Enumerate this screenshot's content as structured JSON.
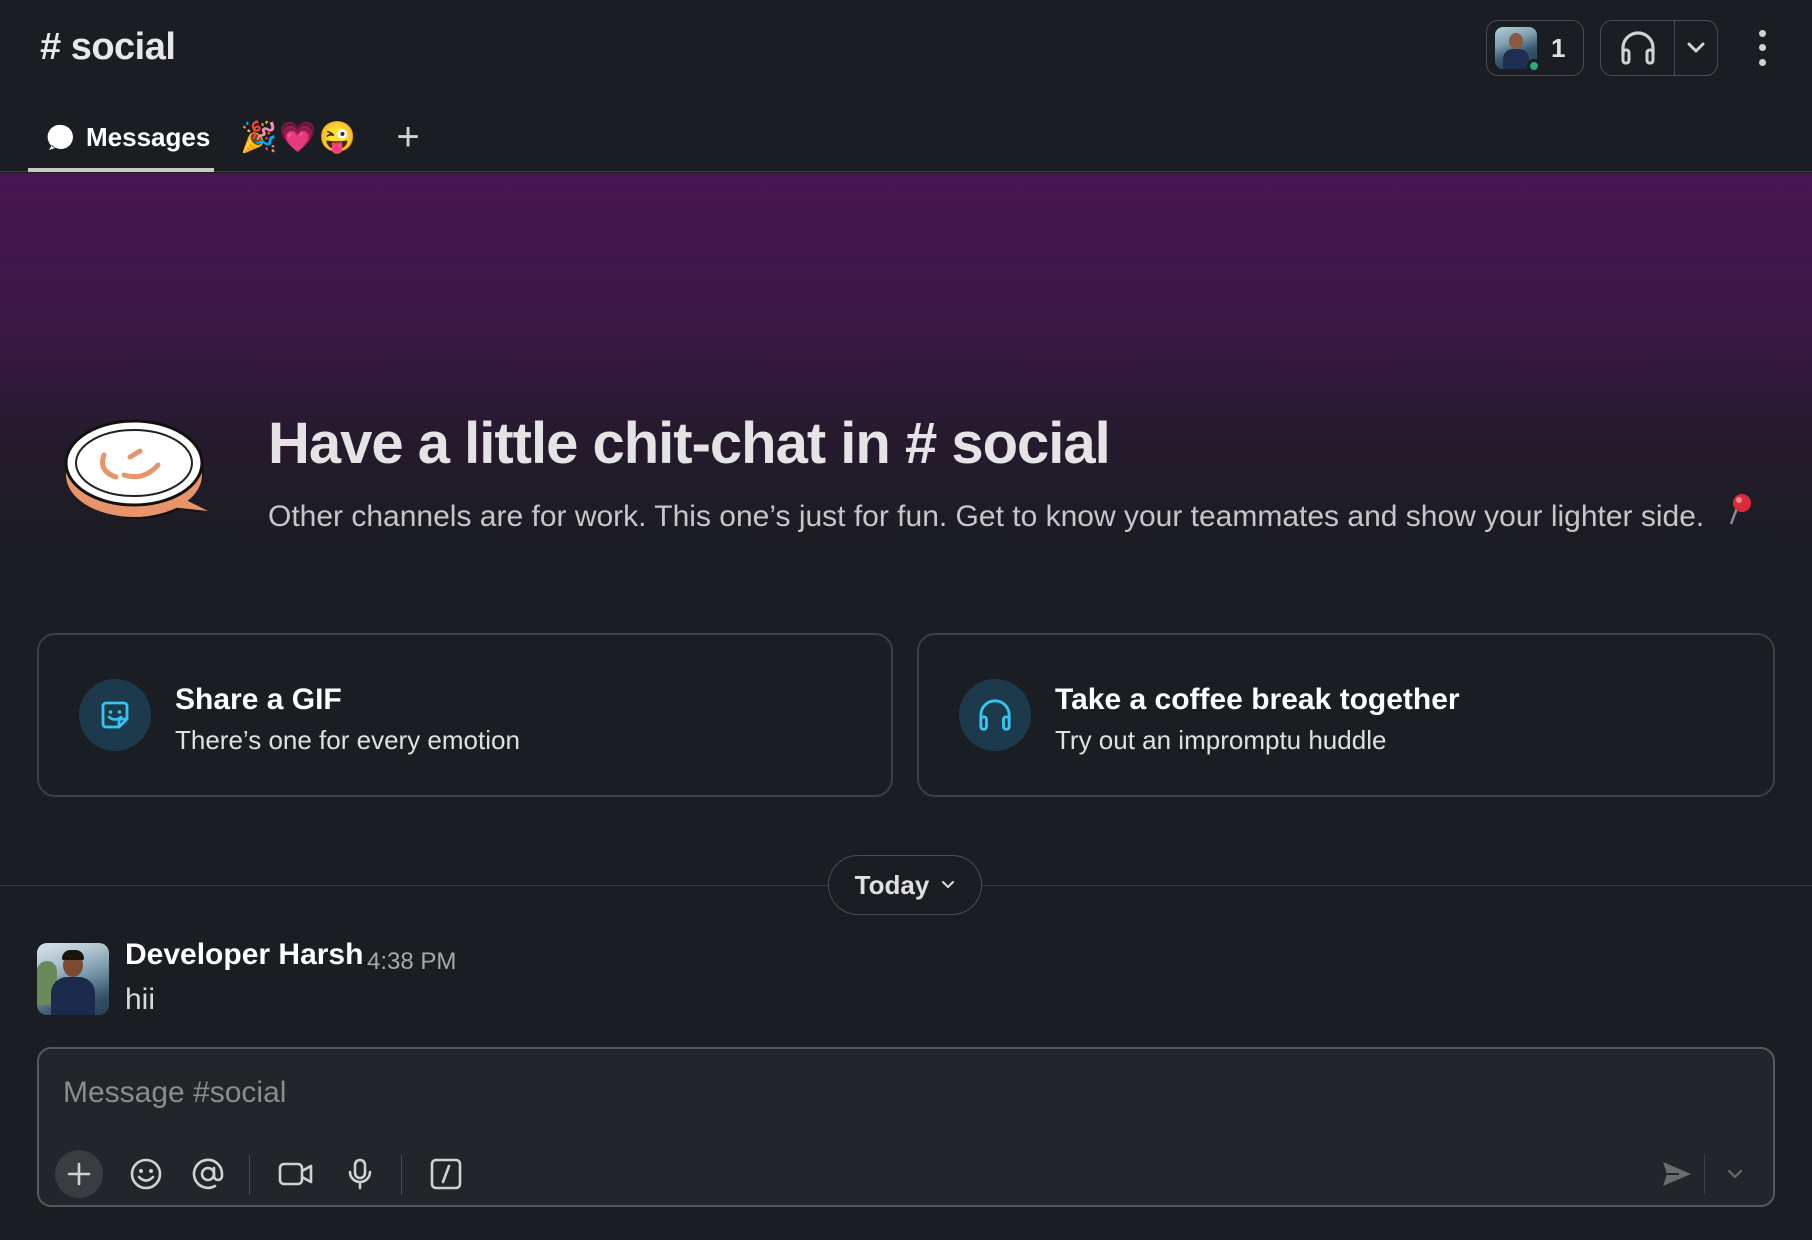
{
  "header": {
    "channel_title": "# social",
    "member_count": "1",
    "tabs": {
      "messages_label": "Messages",
      "emoji_tab": "🎉💗😜",
      "add_label": "+"
    }
  },
  "banner": {
    "title": "Have a little chit-chat in # social",
    "subtitle": "Other channels are for work. This one’s just for fun. Get to know your teammates and show your lighter side."
  },
  "cards": [
    {
      "title": "Share a GIF",
      "subtitle": "There’s one for every emotion",
      "icon": "gif-sticker-icon"
    },
    {
      "title": "Take a coffee break together",
      "subtitle": "Try out an impromptu huddle",
      "icon": "headphones-icon"
    }
  ],
  "date_divider": {
    "label": "Today"
  },
  "messages": [
    {
      "author": "Developer Harsh",
      "time": "4:38 PM",
      "text": "hii"
    }
  ],
  "composer": {
    "placeholder": "Message #social"
  },
  "colors": {
    "background": "#1a1d21",
    "banner_purple": "#481551",
    "presence_green": "#2bac76",
    "card_icon_bg": "#1c3a4c",
    "card_icon_fg": "#36c5f0"
  }
}
